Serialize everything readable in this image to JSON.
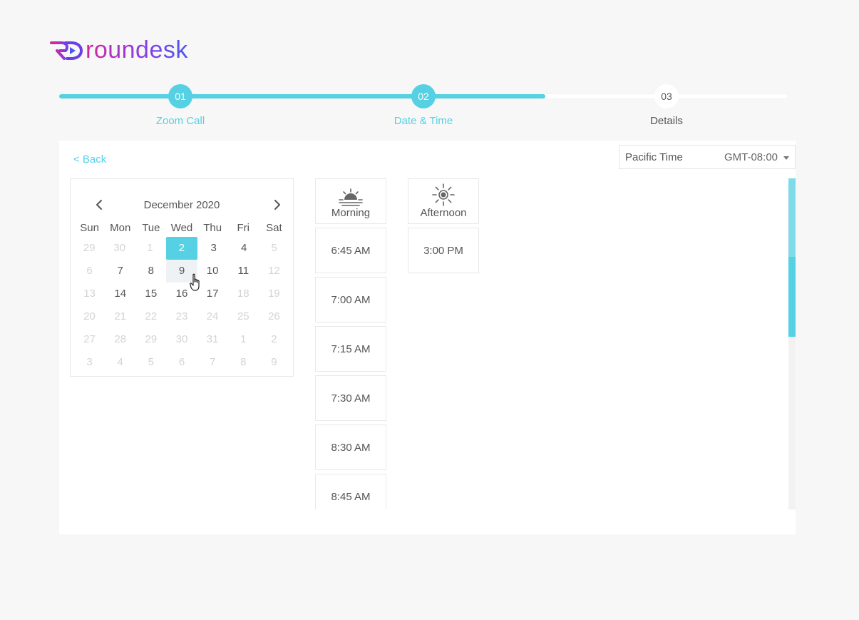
{
  "brand": {
    "name": "roundesk",
    "colors": {
      "accent": "#55d1e3",
      "pink": "#d6249f",
      "blue": "#4a56f0"
    }
  },
  "stepper": {
    "steps": [
      {
        "number": "01",
        "label": "Zoom Call",
        "state": "done"
      },
      {
        "number": "02",
        "label": "Date & Time",
        "state": "done"
      },
      {
        "number": "03",
        "label": "Details",
        "state": "todo"
      }
    ]
  },
  "back_label": "< Back",
  "timezone": {
    "name": "Pacific Time",
    "offset": "GMT-08:00"
  },
  "calendar": {
    "month_label": "December 2020",
    "weekdays": [
      "Sun",
      "Mon",
      "Tue",
      "Wed",
      "Thu",
      "Fri",
      "Sat"
    ],
    "weeks": [
      [
        {
          "d": "29",
          "m": true
        },
        {
          "d": "30",
          "m": true
        },
        {
          "d": "1",
          "m": true
        },
        {
          "d": "2",
          "sel": true
        },
        {
          "d": "3"
        },
        {
          "d": "4"
        },
        {
          "d": "5",
          "m": true
        }
      ],
      [
        {
          "d": "6",
          "m": true
        },
        {
          "d": "7"
        },
        {
          "d": "8"
        },
        {
          "d": "9",
          "hover": true
        },
        {
          "d": "10"
        },
        {
          "d": "11"
        },
        {
          "d": "12",
          "m": true
        }
      ],
      [
        {
          "d": "13",
          "m": true
        },
        {
          "d": "14"
        },
        {
          "d": "15"
        },
        {
          "d": "16"
        },
        {
          "d": "17"
        },
        {
          "d": "18",
          "m": true
        },
        {
          "d": "19",
          "m": true
        }
      ],
      [
        {
          "d": "20",
          "m": true
        },
        {
          "d": "21",
          "m": true
        },
        {
          "d": "22",
          "m": true
        },
        {
          "d": "23",
          "m": true
        },
        {
          "d": "24",
          "m": true
        },
        {
          "d": "25",
          "m": true
        },
        {
          "d": "26",
          "m": true
        }
      ],
      [
        {
          "d": "27",
          "m": true
        },
        {
          "d": "28",
          "m": true
        },
        {
          "d": "29",
          "m": true
        },
        {
          "d": "30",
          "m": true
        },
        {
          "d": "31",
          "m": true
        },
        {
          "d": "1",
          "m": true
        },
        {
          "d": "2",
          "m": true
        }
      ],
      [
        {
          "d": "3",
          "m": true
        },
        {
          "d": "4",
          "m": true
        },
        {
          "d": "5",
          "m": true
        },
        {
          "d": "6",
          "m": true
        },
        {
          "d": "7",
          "m": true
        },
        {
          "d": "8",
          "m": true
        },
        {
          "d": "9",
          "m": true
        }
      ]
    ]
  },
  "morning": {
    "label": "Morning",
    "icon": "sunrise-icon",
    "slots": [
      "6:45 AM",
      "7:00 AM",
      "7:15 AM",
      "7:30 AM",
      "8:30 AM",
      "8:45 AM"
    ]
  },
  "afternoon": {
    "label": "Afternoon",
    "icon": "sun-icon",
    "slots": [
      "3:00 PM"
    ]
  }
}
